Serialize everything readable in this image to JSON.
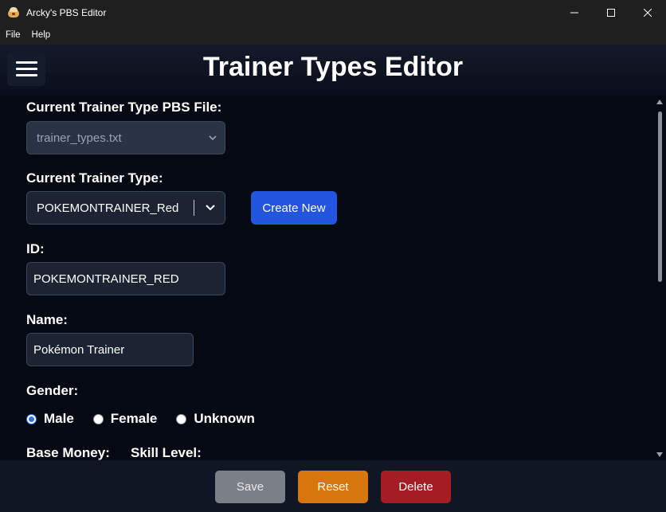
{
  "window": {
    "title": "Arcky's PBS Editor"
  },
  "menu": {
    "items": [
      "File",
      "Help"
    ]
  },
  "header": {
    "title": "Trainer Types Editor"
  },
  "form": {
    "pbs_file": {
      "label": "Current Trainer Type PBS File:",
      "value": "trainer_types.txt"
    },
    "trainer_type": {
      "label": "Current Trainer Type:",
      "value": "POKEMONTRAINER_Red",
      "create_label": "Create New"
    },
    "id": {
      "label": "ID:",
      "value": "POKEMONTRAINER_RED"
    },
    "name": {
      "label": "Name:",
      "value": "Pokémon Trainer"
    },
    "gender": {
      "label": "Gender:",
      "options": [
        "Male",
        "Female",
        "Unknown"
      ],
      "selected": "Male"
    },
    "base_money": {
      "label": "Base Money:"
    },
    "skill_level": {
      "label": "Skill Level:"
    }
  },
  "footer": {
    "save_label": "Save",
    "reset_label": "Reset",
    "delete_label": "Delete"
  },
  "colors": {
    "primary": "#2455e0",
    "reset": "#d7760c",
    "delete": "#a31d22",
    "save": "#7b7f87",
    "background": "#050914"
  }
}
